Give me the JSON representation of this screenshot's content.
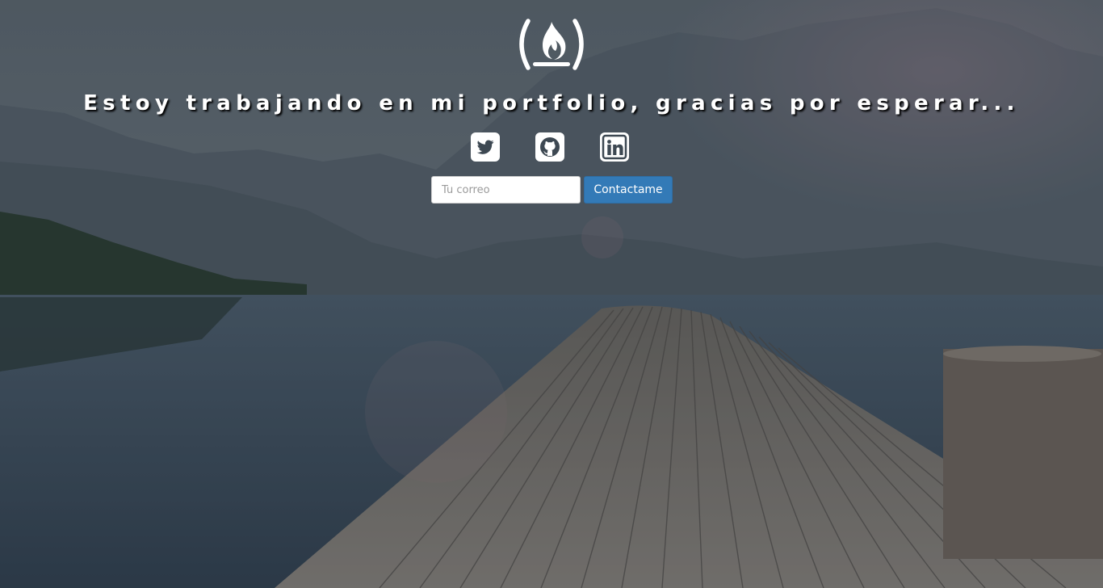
{
  "headline": "Estoy trabajando en mi portfolio, gracias por esperar...",
  "logo": {
    "icon": "freecodecamp-fire-icon"
  },
  "social": [
    {
      "icon": "twitter-icon"
    },
    {
      "icon": "github-icon"
    },
    {
      "icon": "linkedin-icon"
    }
  ],
  "form": {
    "email_placeholder": "Tu correo",
    "email_value": "",
    "submit_label": "Contactame"
  },
  "colors": {
    "button": "#337ab7",
    "text": "#ffffff"
  }
}
